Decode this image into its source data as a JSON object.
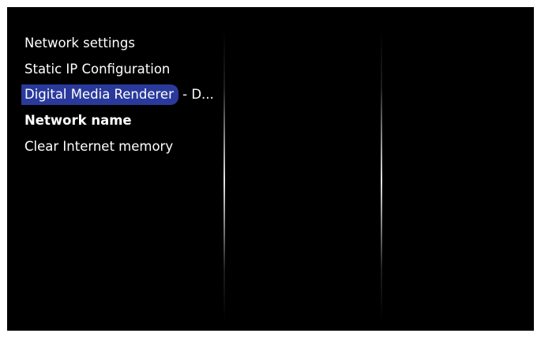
{
  "menu": {
    "items": [
      {
        "label": "Network settings"
      },
      {
        "label": "Static IP Configuration"
      },
      {
        "label": "Digital Media Renderer",
        "suffix": " - D..."
      },
      {
        "label": "Network name"
      },
      {
        "label": "Clear Internet memory"
      }
    ]
  },
  "colors": {
    "background": "#000000",
    "highlight": "#2a3a9c",
    "text": "#ffffff"
  }
}
